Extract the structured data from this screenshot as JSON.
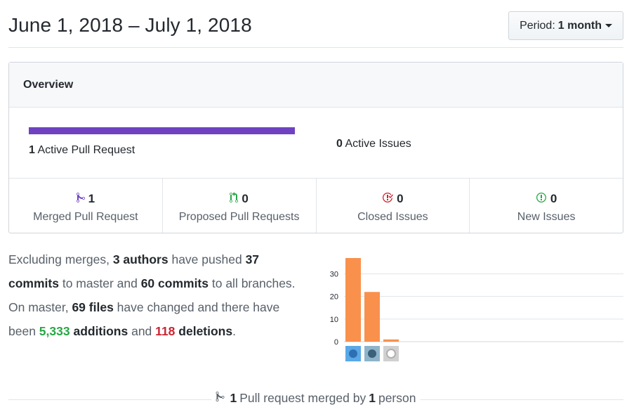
{
  "header": {
    "title": "June 1, 2018 – July 1, 2018",
    "period_label": "Period:",
    "period_value": "1 month"
  },
  "overview": {
    "heading": "Overview",
    "active_pull_requests": {
      "count": "1",
      "label": "Active Pull Request",
      "merged_fraction": 1.0
    },
    "active_issues": {
      "count": "0",
      "label": "Active Issues"
    },
    "stats": [
      {
        "icon": "git-merge-icon",
        "color": "#6f42c1",
        "count": "1",
        "label": "Merged Pull Request"
      },
      {
        "icon": "git-pull-request-icon",
        "color": "#28a745",
        "count": "0",
        "label": "Proposed Pull Requests"
      },
      {
        "icon": "issue-closed-icon",
        "color": "#cb2431",
        "count": "0",
        "label": "Closed Issues"
      },
      {
        "icon": "issue-opened-icon",
        "color": "#28a745",
        "count": "0",
        "label": "New Issues"
      }
    ]
  },
  "summary": {
    "p1": "Excluding merges, ",
    "authors": "3 authors",
    "p2": " have pushed ",
    "commits_master": "37 commits",
    "p3": " to master and ",
    "commits_all": "60 commits",
    "p4": " to all branches. On master, ",
    "files": "69 files",
    "p5": " have changed and there have been ",
    "additions_num": "5,333",
    "additions_word": " additions",
    "p6": " and ",
    "deletions_num": "118",
    "deletions_word": "deletions",
    "p7": "."
  },
  "chart_data": {
    "type": "bar",
    "categories": [
      "author-1",
      "author-2",
      "author-3"
    ],
    "values": [
      37,
      22,
      1
    ],
    "ylim": [
      0,
      37
    ],
    "yticks": [
      0,
      10,
      20,
      30
    ],
    "bar_color": "#f9914c",
    "grid": true,
    "avatars": [
      "avatar-1",
      "avatar-2",
      "avatar-github-default"
    ]
  },
  "footer": {
    "count": "1",
    "p1": "Pull request merged by",
    "people": "1",
    "p2": "person"
  }
}
